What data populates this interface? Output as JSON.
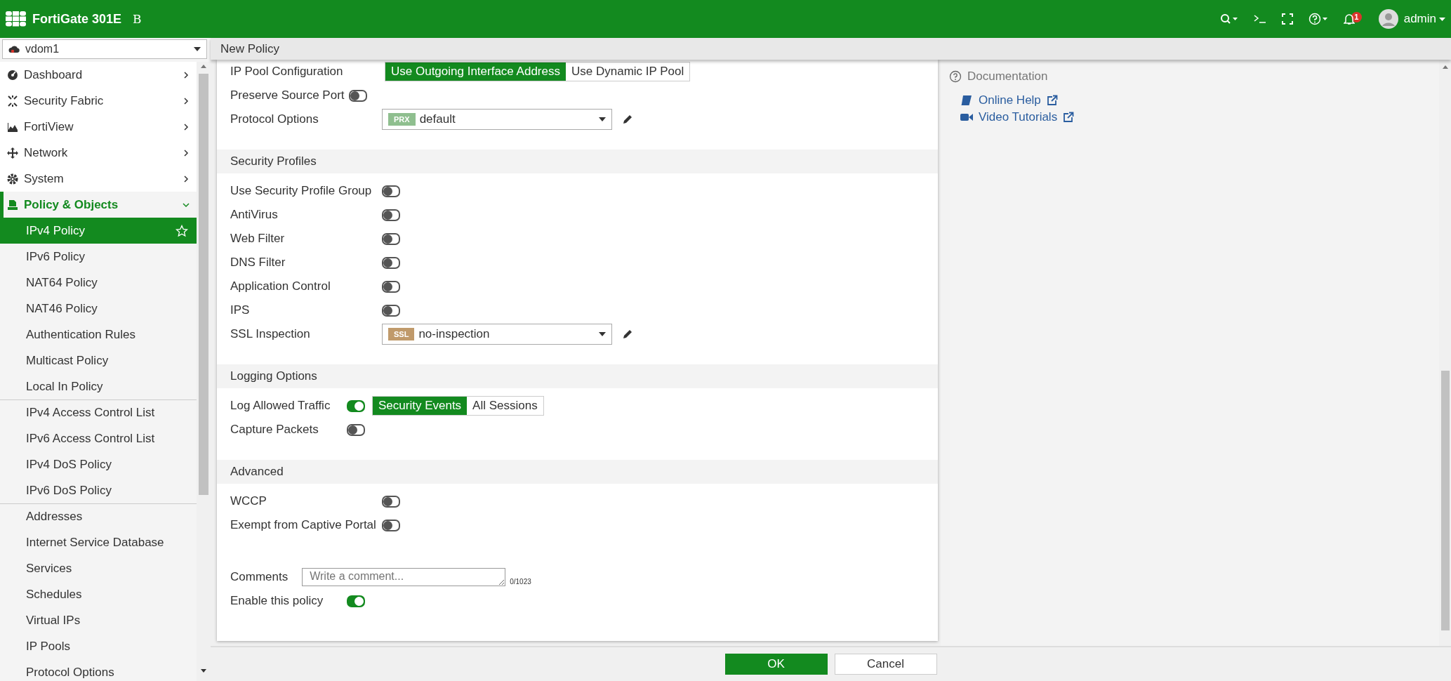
{
  "header": {
    "brand": "FortiGate 301E",
    "mark": "B",
    "notifications": "1",
    "user": "admin"
  },
  "sidebar": {
    "vdom": "vdom1",
    "items": [
      {
        "label": "Dashboard",
        "expanded": false
      },
      {
        "label": "Security Fabric",
        "expanded": false
      },
      {
        "label": "FortiView",
        "expanded": false
      },
      {
        "label": "Network",
        "expanded": false
      },
      {
        "label": "System",
        "expanded": false
      },
      {
        "label": "Policy & Objects",
        "expanded": true,
        "children": [
          {
            "label": "IPv4 Policy",
            "selected": true,
            "divider_above": false
          },
          {
            "label": "IPv6 Policy",
            "selected": false,
            "divider_above": false
          },
          {
            "label": "NAT64 Policy",
            "selected": false,
            "divider_above": false
          },
          {
            "label": "NAT46 Policy",
            "selected": false,
            "divider_above": false
          },
          {
            "label": "Authentication Rules",
            "selected": false,
            "divider_above": false
          },
          {
            "label": "Multicast Policy",
            "selected": false,
            "divider_above": false
          },
          {
            "label": "Local In Policy",
            "selected": false,
            "divider_above": false
          },
          {
            "label": "IPv4 Access Control List",
            "selected": false,
            "divider_above": true
          },
          {
            "label": "IPv6 Access Control List",
            "selected": false,
            "divider_above": false
          },
          {
            "label": "IPv4 DoS Policy",
            "selected": false,
            "divider_above": false
          },
          {
            "label": "IPv6 DoS Policy",
            "selected": false,
            "divider_above": false
          },
          {
            "label": "Addresses",
            "selected": false,
            "divider_above": true
          },
          {
            "label": "Internet Service Database",
            "selected": false,
            "divider_above": false
          },
          {
            "label": "Services",
            "selected": false,
            "divider_above": false
          },
          {
            "label": "Schedules",
            "selected": false,
            "divider_above": false
          },
          {
            "label": "Virtual IPs",
            "selected": false,
            "divider_above": false
          },
          {
            "label": "IP Pools",
            "selected": false,
            "divider_above": false
          },
          {
            "label": "Protocol Options",
            "selected": false,
            "divider_above": false
          }
        ]
      }
    ]
  },
  "page_title": "New Policy",
  "sections": [
    {
      "rows": [
        {
          "kind": "segmented",
          "label": "IP Pool Configuration",
          "options": [
            {
              "label": "Use Outgoing Interface Address",
              "selected": true
            },
            {
              "label": "Use Dynamic IP Pool",
              "selected": false
            }
          ]
        },
        {
          "kind": "toggle",
          "label": "Preserve Source Port",
          "on": false
        },
        {
          "kind": "select",
          "label": "Protocol Options",
          "badge": "PRX",
          "color": "#8fbf8f",
          "value": "default"
        }
      ]
    },
    {
      "title": "Security Profiles",
      "rows": [
        {
          "kind": "toggle",
          "label": "Use Security Profile Group",
          "on": false
        },
        {
          "kind": "toggle",
          "label": "AntiVirus",
          "on": false
        },
        {
          "kind": "toggle",
          "label": "Web Filter",
          "on": false
        },
        {
          "kind": "toggle",
          "label": "DNS Filter",
          "on": false
        },
        {
          "kind": "toggle",
          "label": "Application Control",
          "on": false
        },
        {
          "kind": "toggle",
          "label": "IPS",
          "on": false
        },
        {
          "kind": "select",
          "label": "SSL Inspection",
          "badge": "SSL",
          "color": "#c09a6b",
          "value": "no-inspection"
        }
      ]
    },
    {
      "title": "Logging Options",
      "rows": [
        {
          "kind": "toggle",
          "label": "Log Allowed Traffic",
          "on": true,
          "options": [
            {
              "label": "Security Events",
              "selected": true
            },
            {
              "label": "All Sessions",
              "selected": false
            }
          ]
        },
        {
          "kind": "toggle",
          "label": "Capture Packets",
          "on": false
        }
      ]
    },
    {
      "title": "Advanced",
      "rows": [
        {
          "kind": "toggle",
          "label": "WCCP",
          "on": false
        },
        {
          "kind": "toggle",
          "label": "Exempt from Captive Portal",
          "on": false
        }
      ]
    },
    {
      "rows": [
        {
          "kind": "textarea",
          "label": "Comments",
          "placeholder": "Write a comment...",
          "counter": "0/1023"
        },
        {
          "kind": "toggle",
          "label": "Enable this policy",
          "on": true
        }
      ]
    }
  ],
  "documentation": {
    "title": "Documentation",
    "links": [
      {
        "label": "Online Help"
      },
      {
        "label": "Video Tutorials"
      }
    ]
  },
  "buttons": [
    {
      "label": "OK",
      "primary": true
    },
    {
      "label": "Cancel",
      "primary": false
    }
  ]
}
